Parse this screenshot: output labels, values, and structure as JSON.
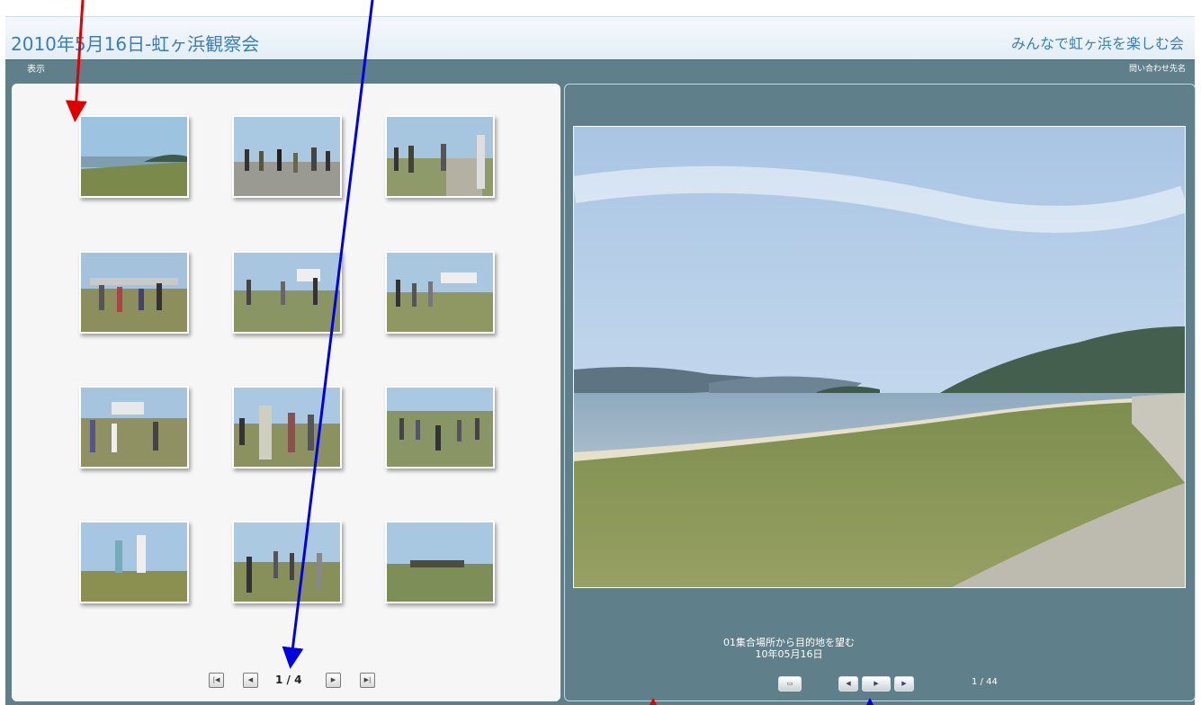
{
  "header": {
    "title": "2010年5月16日-虹ヶ浜観察会",
    "org": "みんなで虹ヶ浜を楽しむ会"
  },
  "subbar": {
    "left": "表示",
    "right": "問い合わせ先名"
  },
  "gallery": {
    "thumbnail_count": 12,
    "pager": {
      "first_icon": "first-page-icon",
      "prev_icon": "prev-page-icon",
      "page_text": "1 / 4",
      "next_icon": "next-page-icon",
      "last_icon": "last-page-icon"
    }
  },
  "viewer": {
    "caption_line1": "01集合場所から目的地を望む",
    "caption_line2": "10年05月16日",
    "counter": "1 / 44",
    "controls": {
      "fullscreen_icon": "fullscreen-icon",
      "prev_icon": "previous-icon",
      "play_icon": "play-icon",
      "next_icon": "next-icon"
    }
  },
  "colors": {
    "accent": "#3a7eb6",
    "panel": "#5f7f8a",
    "gallery_bg": "#f6f6f6",
    "arrow_red": "#e00000",
    "arrow_blue": "#0000e0"
  }
}
